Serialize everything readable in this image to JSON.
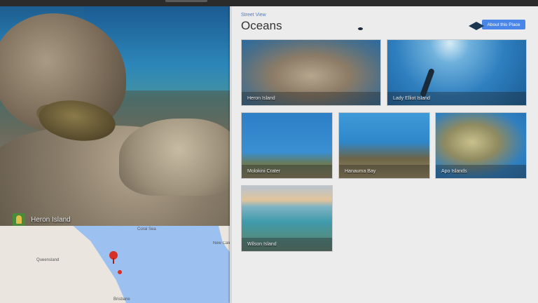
{
  "pano": {
    "location_label": "Heron Island"
  },
  "map": {
    "labels": {
      "coral_sea": "Coral Sea",
      "queensland": "Queensland",
      "brisbane": "Brisbane",
      "caledonia": "New Caledonia"
    }
  },
  "panel": {
    "breadcrumb": "Street View",
    "title": "Oceans",
    "about_button": "About this Place",
    "tiles": [
      {
        "label": "Heron Island"
      },
      {
        "label": "Lady Elliot Island"
      },
      {
        "label": "Molokini Crater"
      },
      {
        "label": "Hanauma Bay"
      },
      {
        "label": "Apo Islands"
      },
      {
        "label": "Wilson Island"
      }
    ]
  },
  "colors": {
    "accent": "#4a86e8",
    "pin": "#d93025",
    "panel_bg": "#ececec"
  }
}
